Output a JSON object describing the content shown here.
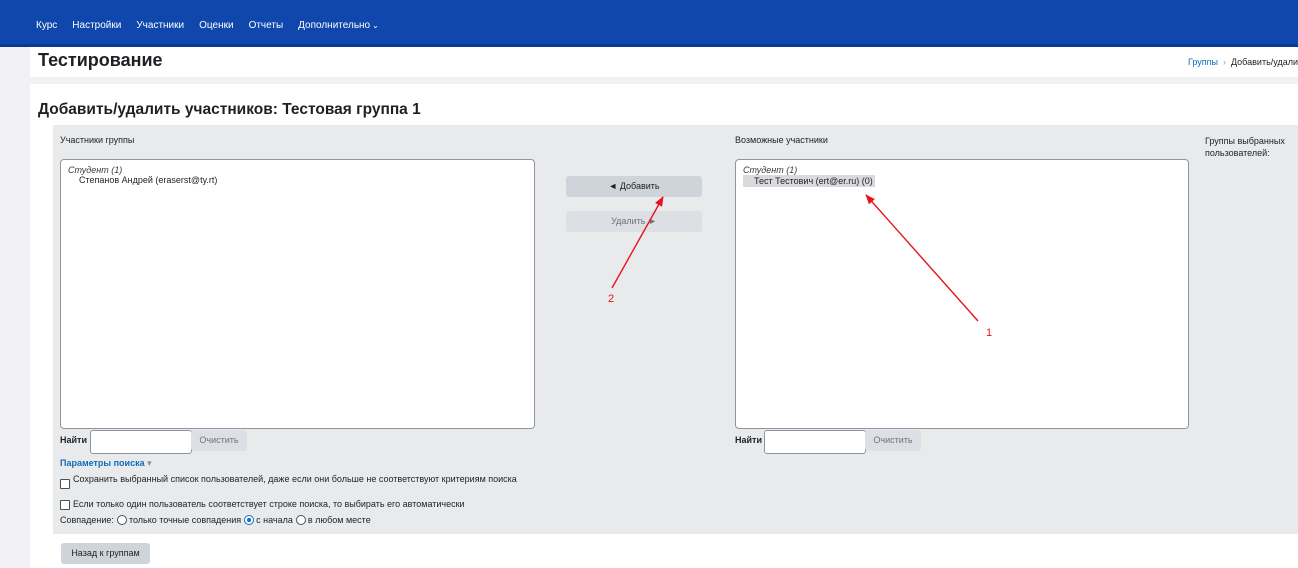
{
  "nav": {
    "items": [
      "Курс",
      "Настройки",
      "Участники",
      "Оценки",
      "Отчеты"
    ],
    "more_label": "Дополнительно",
    "more_icon": "chevron-down-icon"
  },
  "header": {
    "title": "Тестирование",
    "breadcrumb": [
      "Группы",
      "Добавить/удали"
    ]
  },
  "main": {
    "heading": "Добавить/удалить участников: Тестовая группа 1",
    "group_members": {
      "label": "Участники группы",
      "group_label": "Студент (1)",
      "items": [
        "Степанов Андрей (eraserst@ty.rt)"
      ],
      "search_label": "Найти",
      "search_value": "",
      "clear_label": "Очистить"
    },
    "actions": {
      "add_label": "◄ Добавить",
      "remove_label": "Удалить ►"
    },
    "potential_members": {
      "label": "Возможные участники",
      "group_label": "Студент (1)",
      "items": [
        "Тест Тестович (ert@er.ru) (0)"
      ],
      "search_label": "Найти",
      "search_value": "",
      "clear_label": "Очистить"
    },
    "selected_groups": {
      "label": "Группы выбранных пользователей:"
    },
    "search_options": {
      "toggle_label": "Параметры поиска",
      "toggle_icon": "caret-down-icon",
      "keep_selected": "Сохранить выбранный список пользователей, даже если они больше не соответствуют критериям поиска",
      "keep_selected_checked": false,
      "auto_select": "Если только один пользователь соответствует строке поиска, то выбирать его автоматически",
      "auto_select_checked": false,
      "match_label": "Совпадение:",
      "match_options": [
        "только точные совпадения",
        "с начала",
        "в любом месте"
      ],
      "match_selected": "с начала"
    },
    "back_button": "Назад к группам"
  },
  "annotations": {
    "labels": [
      "1",
      "2"
    ],
    "color": "#e8131b"
  },
  "colors": {
    "topbar": "#0f47ad",
    "link": "#0f6cbf"
  }
}
